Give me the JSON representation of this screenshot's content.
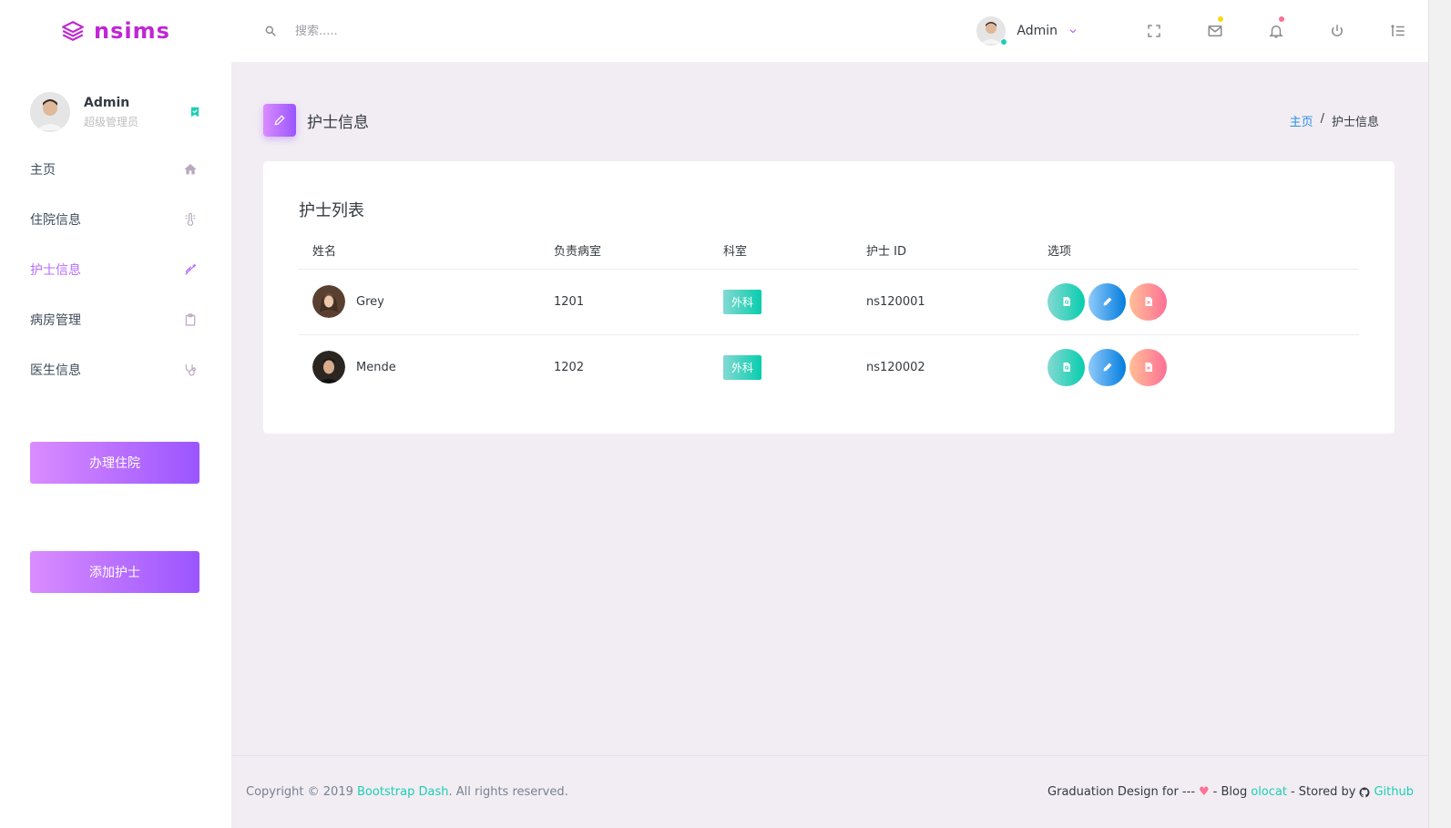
{
  "brand": {
    "name": "nsims",
    "icon": "layers-icon",
    "color": "#c026d3"
  },
  "search": {
    "placeholder": "搜索....."
  },
  "navbar": {
    "user_name": "Admin",
    "icons": [
      "fullscreen-icon",
      "mail-icon",
      "bell-icon",
      "power-icon",
      "menu-list-icon"
    ],
    "mail_dot_color": "#fed713",
    "bell_dot_color": "#fe7096"
  },
  "sidebar": {
    "profile": {
      "name": "Admin",
      "role": "超级管理员",
      "badge_icon": "bookmark-check-icon"
    },
    "items": [
      {
        "label": "主页",
        "icon": "home-icon",
        "active": false
      },
      {
        "label": "住院信息",
        "icon": "thermometer-icon",
        "active": false
      },
      {
        "label": "护士信息",
        "icon": "syringe-icon",
        "active": true
      },
      {
        "label": "病房管理",
        "icon": "clipboard-icon",
        "active": false
      },
      {
        "label": "医生信息",
        "icon": "stethoscope-icon",
        "active": false
      }
    ],
    "buttons": {
      "admit": "办理住院",
      "add_nurse": "添加护士"
    },
    "accent_color": "#b66dff"
  },
  "page": {
    "title": "护士信息",
    "icon": "pencil-icon",
    "breadcrumb": {
      "home": "主页",
      "separator": "/",
      "current": "护士信息"
    }
  },
  "table": {
    "title": "护士列表",
    "headers": [
      "姓名",
      "负责病室",
      "科室",
      "护士 ID",
      "选项"
    ],
    "rows": [
      {
        "name": "Grey",
        "ward": "1201",
        "department": "外科",
        "nurse_id": "ns120001"
      },
      {
        "name": "Mende",
        "ward": "1202",
        "department": "外科",
        "nurse_id": "ns120002"
      }
    ],
    "action_icons": [
      "view-icon",
      "edit-icon",
      "delete-icon"
    ]
  },
  "footer": {
    "copyright_prefix": "Copyright © 2019 ",
    "copyright_link": "Bootstrap Dash",
    "copyright_suffix": ". All rights reserved.",
    "right_prefix": "Graduation Design for ---",
    "heart": "♥",
    "blog_text": "- Blog",
    "blog_link": "olocat",
    "stored_text": "- Stored by",
    "github_link": "Github",
    "link_color": "#1bcfb4"
  }
}
